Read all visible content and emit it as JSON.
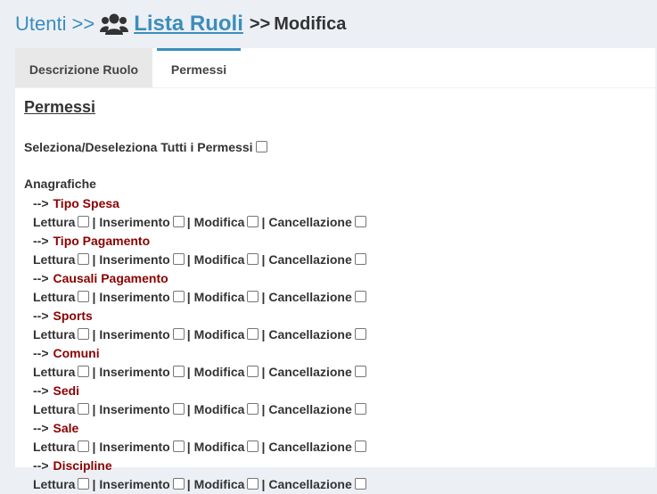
{
  "breadcrumb": {
    "root": "Utenti",
    "sep1": ">>",
    "icon": "users-icon",
    "link": "Lista Ruoli",
    "sep2": ">>",
    "current": "Modifica"
  },
  "tabs": [
    {
      "label": "Descrizione Ruolo",
      "active": false
    },
    {
      "label": "Permessi",
      "active": true
    }
  ],
  "section_title": "Permessi",
  "select_all_label": "Seleziona/Deseleziona Tutti i Permessi",
  "group_title": "Anagrafiche",
  "arrow": "-->",
  "perm_labels": {
    "read": "Lettura",
    "insert": "Inserimento",
    "edit": "Modifica",
    "delete": "Cancellazione",
    "pipe": "|"
  },
  "items": [
    {
      "name": "Tipo Spesa"
    },
    {
      "name": "Tipo Pagamento"
    },
    {
      "name": "Causali Pagamento"
    },
    {
      "name": "Sports"
    },
    {
      "name": "Comuni"
    },
    {
      "name": "Sedi"
    },
    {
      "name": "Sale"
    },
    {
      "name": "Discipline"
    }
  ],
  "colors": {
    "link": "#3c8dbc",
    "item_name": "#8b0000",
    "background": "#ecf0f5"
  }
}
